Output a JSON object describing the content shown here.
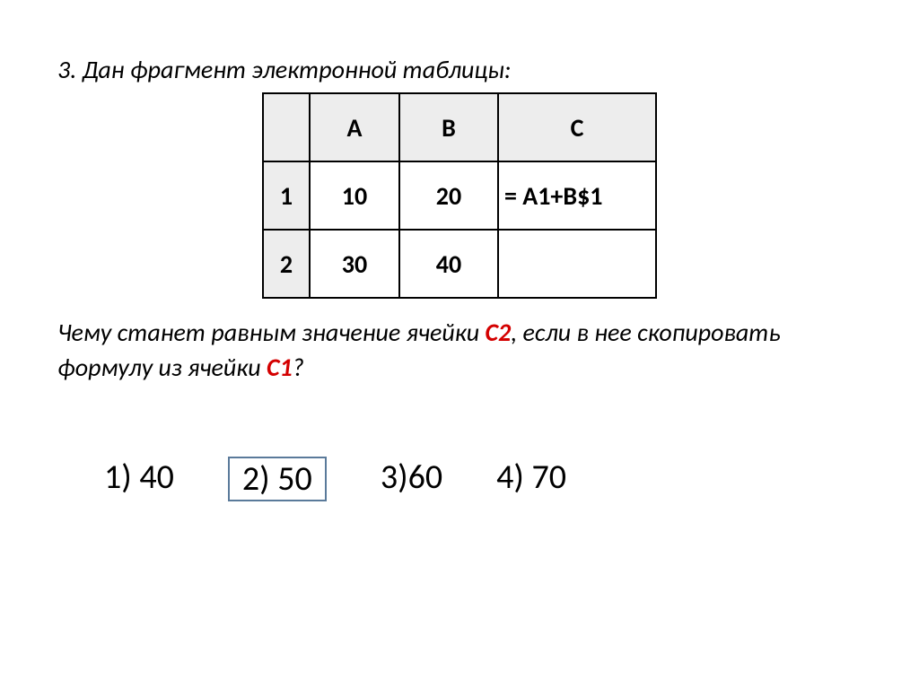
{
  "question": {
    "prefix_text": "3. Дан фрагмент электронной таблицы:",
    "after_part1": "Чему станет равным значение ячейки ",
    "after_ref1": "С2",
    "after_part2": ", если в нее скопировать формулу из ячейки ",
    "after_ref2": "С1",
    "after_part3": "?"
  },
  "sheet": {
    "headers": {
      "A": "A",
      "B": "B",
      "C": "C"
    },
    "rows": [
      {
        "num": "1",
        "A": "10",
        "B": "20",
        "C": "= A1+B$1"
      },
      {
        "num": "2",
        "A": "30",
        "B": "40",
        "C": ""
      }
    ]
  },
  "answers": [
    {
      "label": "1) 40",
      "boxed": false
    },
    {
      "label": "2) 50",
      "boxed": true
    },
    {
      "label": "3)60",
      "boxed": false
    },
    {
      "label": "4) 70",
      "boxed": false
    }
  ],
  "chart_data": {
    "type": "table",
    "title": "Фрагмент электронной таблицы",
    "columns": [
      "",
      "A",
      "B",
      "C"
    ],
    "rows": [
      [
        "1",
        10,
        20,
        "= A1+B$1"
      ],
      [
        "2",
        30,
        40,
        ""
      ]
    ],
    "answer_options": [
      "40",
      "50",
      "60",
      "70"
    ],
    "correct_answer": "50"
  }
}
